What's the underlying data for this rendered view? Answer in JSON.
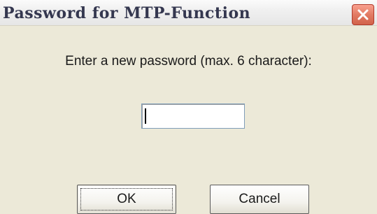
{
  "window": {
    "title": "Password for MTP-Function"
  },
  "titlebar": {
    "close_icon": "close-icon"
  },
  "dialog": {
    "prompt": "Enter a new password (max. 6 character):",
    "password_value": "",
    "ok_label": "OK",
    "cancel_label": "Cancel"
  },
  "colors": {
    "background": "#ECE9D8",
    "close_button": "#E27B63",
    "title_text": "#34374F"
  }
}
